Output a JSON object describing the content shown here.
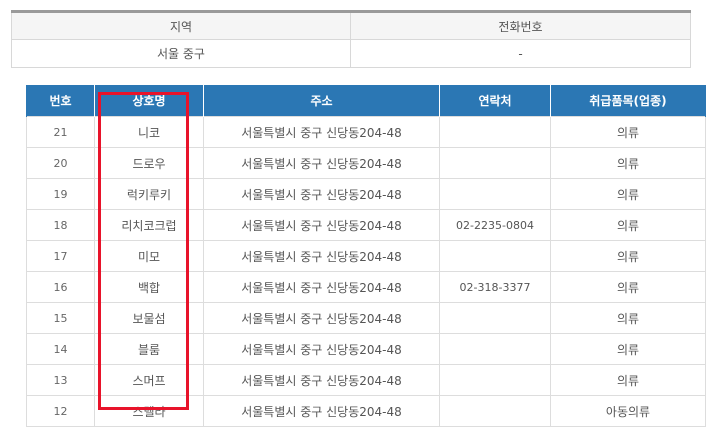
{
  "info": {
    "headers": [
      "지역",
      "전화번호"
    ],
    "values": [
      "서울 중구",
      "-"
    ]
  },
  "list": {
    "headers": [
      "번호",
      "상호명",
      "주소",
      "연락처",
      "취급품목(업종)"
    ],
    "rows": [
      {
        "no": "21",
        "name": "니코",
        "address": "서울특별시 중구 신당동204-48",
        "tel": "",
        "item": "의류"
      },
      {
        "no": "20",
        "name": "드로우",
        "address": "서울특별시 중구 신당동204-48",
        "tel": "",
        "item": "의류"
      },
      {
        "no": "19",
        "name": "럭키루키",
        "address": "서울특별시 중구 신당동204-48",
        "tel": "",
        "item": "의류"
      },
      {
        "no": "18",
        "name": "리치코크럽",
        "address": "서울특별시 중구 신당동204-48",
        "tel": "02-2235-0804",
        "item": "의류"
      },
      {
        "no": "17",
        "name": "미모",
        "address": "서울특별시 중구 신당동204-48",
        "tel": "",
        "item": "의류"
      },
      {
        "no": "16",
        "name": "백합",
        "address": "서울특별시 중구 신당동204-48",
        "tel": "02-318-3377",
        "item": "의류"
      },
      {
        "no": "15",
        "name": "보물섬",
        "address": "서울특별시 중구 신당동204-48",
        "tel": "",
        "item": "의류"
      },
      {
        "no": "14",
        "name": "블룸",
        "address": "서울특별시 중구 신당동204-48",
        "tel": "",
        "item": "의류"
      },
      {
        "no": "13",
        "name": "스머프",
        "address": "서울특별시 중구 신당동204-48",
        "tel": "",
        "item": "의류"
      },
      {
        "no": "12",
        "name": "스텔라",
        "address": "서울특별시 중구 신당동204-48",
        "tel": "",
        "item": "아동의류"
      }
    ]
  },
  "highlight": {
    "color": "#e8132a"
  },
  "colors": {
    "header_bg": "#2b77b4",
    "header_text": "#ffffff",
    "border": "#dddddd"
  }
}
